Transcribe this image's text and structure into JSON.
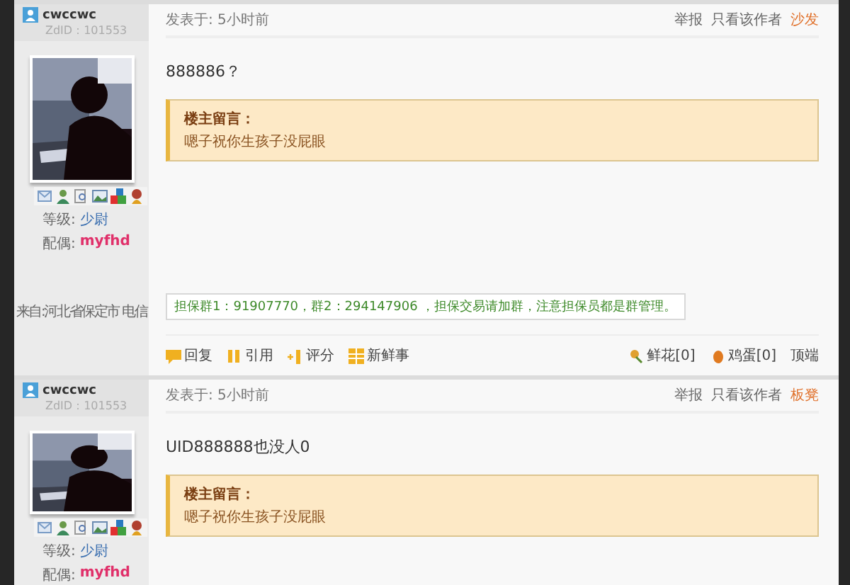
{
  "posts": [
    {
      "author": "cwccwc",
      "zid": "ZdID：101553",
      "posted": "发表于: 5小时前",
      "report": "举报",
      "author_only": "只看该作者",
      "floor": "沙发",
      "body": "888886？",
      "note_title": "楼主留言：",
      "note_text": "嗯子祝你生孩子没屁眼",
      "level_label": "等级:",
      "level": "少尉",
      "spouse_label": "配偶:",
      "spouse": "myfhd",
      "location": "来自:河北省保定市 电信",
      "notice": "担保群1：91907770，群2：294147906 ，担保交易请加群，注意担保员都是群管理。",
      "actions": [
        "回复",
        "引用",
        "评分",
        "新鲜事"
      ],
      "flowers": "鲜花[0]",
      "eggs": "鸡蛋[0]",
      "top": "顶端"
    },
    {
      "author": "cwccwc",
      "zid": "ZdID：101553",
      "posted": "发表于: 5小时前",
      "report": "举报",
      "author_only": "只看该作者",
      "floor": "板凳",
      "body": "UID888888也没人0",
      "note_title": "楼主留言：",
      "note_text": "嗯子祝你生孩子没屁眼",
      "level_label": "等级:",
      "level": "少尉",
      "spouse_label": "配偶:",
      "spouse": "myfhd"
    }
  ]
}
